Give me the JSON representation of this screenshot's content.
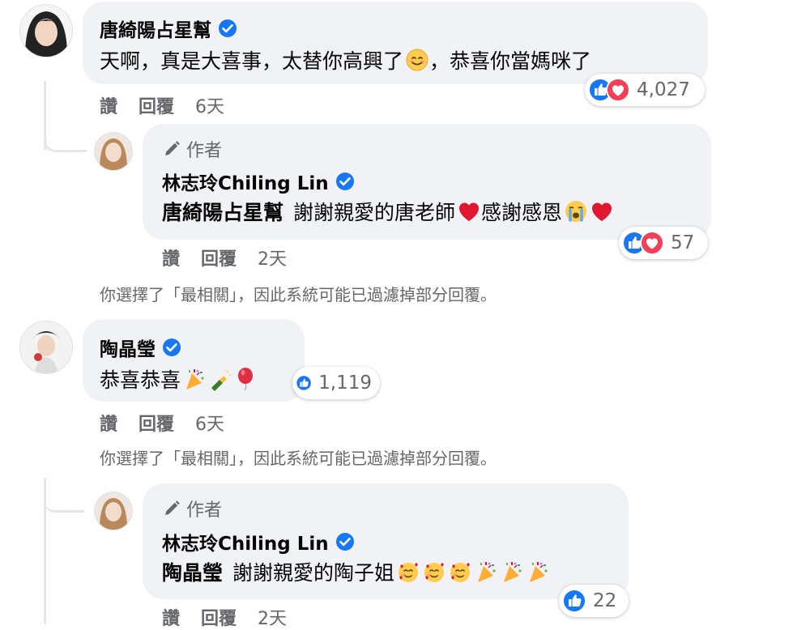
{
  "comments": [
    {
      "name": "唐綺陽占星幫",
      "text": "天啊，真是大喜事，太替你高興了",
      "text_after": "，恭喜你當媽咪了",
      "reaction_count": "4,027",
      "actions": {
        "like": "讚",
        "reply": "回覆",
        "time": "6天"
      }
    },
    {
      "author_badge": "作者",
      "name": "林志玲Chiling Lin",
      "tag": "唐綺陽占星幫",
      "text": "謝謝親愛的唐老師",
      "text_mid": "感謝感恩",
      "reaction_count": "57",
      "actions": {
        "like": "讚",
        "reply": "回覆",
        "time": "2天"
      }
    },
    {
      "name": "陶晶瑩",
      "text": "恭喜恭喜",
      "reaction_count": "1,119",
      "actions": {
        "like": "讚",
        "reply": "回覆",
        "time": "6天"
      }
    },
    {
      "author_badge": "作者",
      "name": "林志玲Chiling Lin",
      "tag": "陶晶瑩",
      "text": "謝謝親愛的陶子姐",
      "reaction_count": "22",
      "actions": {
        "like": "讚",
        "reply": "回覆",
        "time": "2天"
      }
    }
  ],
  "filter_notice": "你選擇了「最相關」，因此系統可能已過濾掉部分回覆。",
  "colors": {
    "verified": "#1877f2",
    "like": "#1877f2",
    "love": "#f33e58",
    "bubble": "#f0f2f5",
    "meta": "#65676b"
  },
  "icons": {
    "verified": "verified-badge-icon",
    "author": "pencil-icon",
    "like": "like-reaction-icon",
    "love": "love-reaction-icon"
  }
}
